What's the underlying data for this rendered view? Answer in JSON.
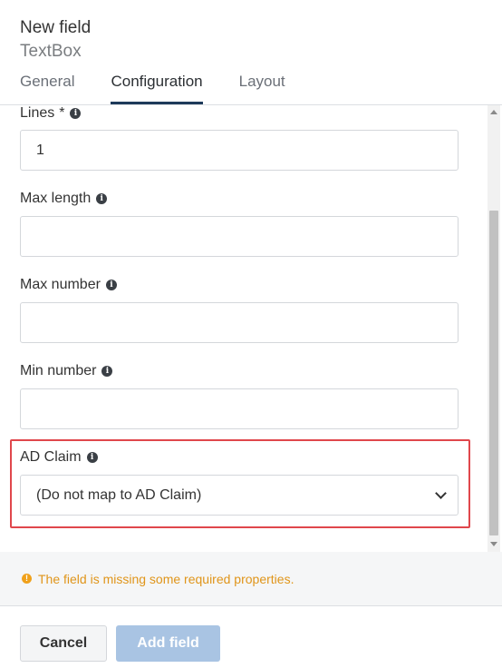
{
  "header": {
    "title": "New field",
    "subtitle": "TextBox",
    "tabs": [
      {
        "label": "General",
        "active": false
      },
      {
        "label": "Configuration",
        "active": true
      },
      {
        "label": "Layout",
        "active": false
      }
    ]
  },
  "form": {
    "lines": {
      "label": "Lines",
      "required_mark": "*",
      "value": "1"
    },
    "max_length": {
      "label": "Max length",
      "value": ""
    },
    "max_number": {
      "label": "Max number",
      "value": ""
    },
    "min_number": {
      "label": "Min number",
      "value": ""
    },
    "ad_claim": {
      "label": "AD Claim",
      "selected": "(Do not map to AD Claim)"
    }
  },
  "warning": {
    "text": "The field is missing some required properties.",
    "icon": "exclamation-circle-icon",
    "color": "#e0951a"
  },
  "footer": {
    "cancel_label": "Cancel",
    "add_label": "Add field",
    "add_disabled": true
  },
  "colors": {
    "accent": "#1e3a5a",
    "highlight": "#e0474c",
    "add_button_disabled": "#a9c4e3"
  }
}
